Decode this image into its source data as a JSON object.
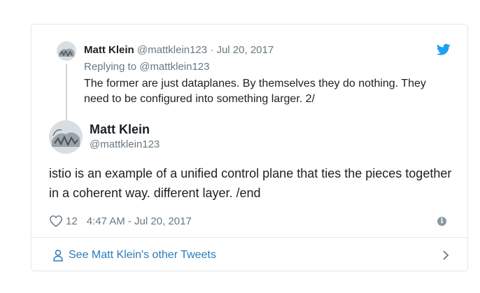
{
  "parent_tweet": {
    "name": "Matt Klein",
    "handle": "@mattklein123",
    "separator": "·",
    "date": "Jul 20, 2017",
    "replying_to": "Replying to @mattklein123",
    "text": "The former are just dataplanes. By themselves they do nothing. They need to be configured into something larger. 2/"
  },
  "main_tweet": {
    "name": "Matt Klein",
    "handle": "@mattklein123",
    "text": "istio is an example of a unified control plane that ties the pieces together in a coherent way. different layer. /end",
    "like_count": "12",
    "timestamp": "4:47 AM - Jul 20, 2017"
  },
  "footer": {
    "link_text": "See Matt Klein's other Tweets"
  },
  "icons": {
    "brand": "twitter-bird-icon",
    "like": "heart-icon",
    "info": "info-icon",
    "person": "person-icon",
    "next": "chevron-right-icon"
  },
  "colors": {
    "twitter_blue": "#1da1f2",
    "link_blue": "#2b7bb9",
    "muted_text": "#697882",
    "border": "#e1e8ed"
  }
}
